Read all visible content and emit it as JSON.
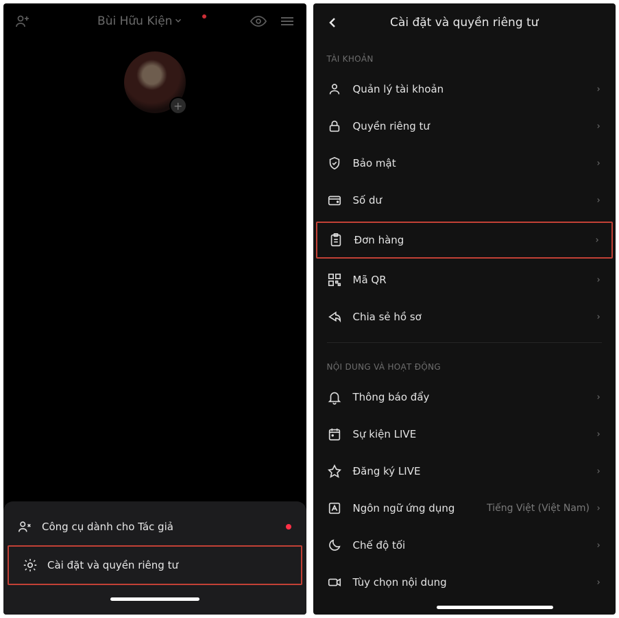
{
  "left": {
    "profile_name": "Bùi Hữu Kiện",
    "sheet": {
      "creator_tools": "Công cụ dành cho Tác giả",
      "settings_privacy": "Cài đặt và quyền riêng tư"
    }
  },
  "right": {
    "title": "Cài đặt và quyền riêng tư",
    "sections": {
      "account_header": "TÀI KHOẢN",
      "content_header": "NỘI DUNG VÀ HOẠT ĐỘNG"
    },
    "items": {
      "manage_account": "Quản lý tài khoản",
      "privacy": "Quyền riêng tư",
      "security": "Bảo mật",
      "balance": "Số dư",
      "orders": "Đơn hàng",
      "qr_code": "Mã QR",
      "share_profile": "Chia sẻ hồ sơ",
      "push_notifications": "Thông báo đẩy",
      "live_events": "Sự kiện LIVE",
      "live_subscribe": "Đăng ký LIVE",
      "app_language": "Ngôn ngữ ứng dụng",
      "app_language_value": "Tiếng Việt (Việt Nam)",
      "dark_mode": "Chế độ tối",
      "content_preferences": "Tùy chọn nội dung"
    }
  }
}
